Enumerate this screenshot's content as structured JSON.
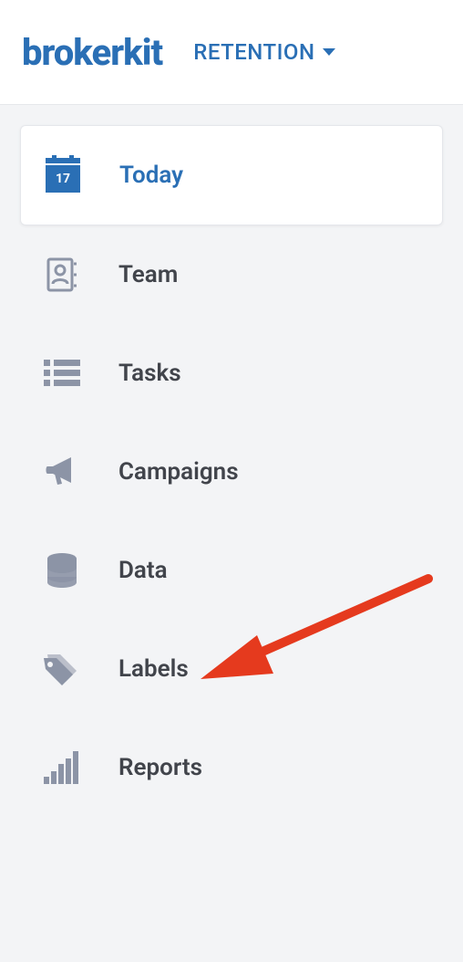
{
  "logo": "brokerkit",
  "section_label": "RETENTION",
  "calendar_day": "17",
  "nav": {
    "today": "Today",
    "team": "Team",
    "tasks": "Tasks",
    "campaigns": "Campaigns",
    "data": "Data",
    "labels": "Labels",
    "reports": "Reports"
  }
}
